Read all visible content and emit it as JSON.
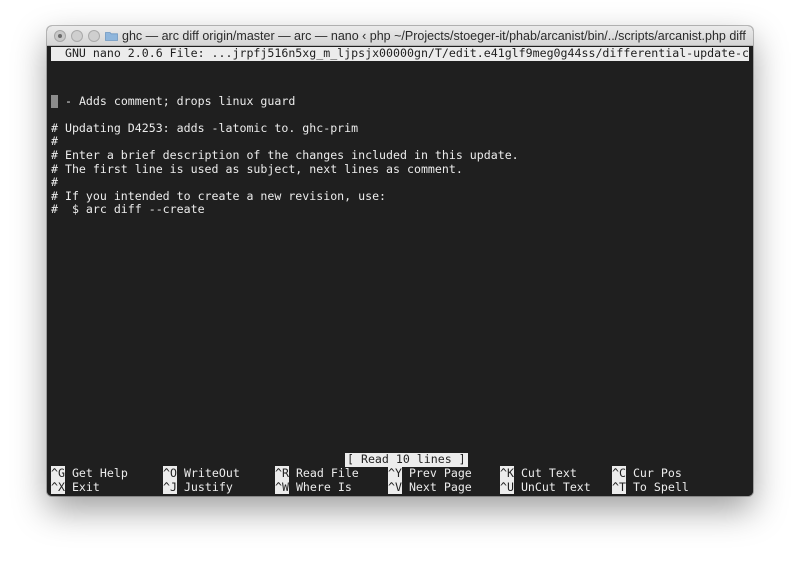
{
  "window": {
    "title": "ghc — arc diff origin/master — arc — nano ‹ php ~/Projects/stoeger-it/phab/arcanist/bin/../scripts/arcanist.php diff origin/m..."
  },
  "nano": {
    "header": "  GNU nano 2.0.6 File: ...jrpfj516n5xg_m_ljpsjx00000gn/T/edit.e41glf9meg0g44ss/differential-update-comments",
    "lines": [
      "",
      " - Adds comment; drops linux guard",
      "",
      "",
      "# Updating D4253: adds -latomic to. ghc-prim",
      "#",
      "# Enter a brief description of the changes included in this update.",
      "# The first line is used as subject, next lines as comment.",
      "#",
      "# If you intended to create a new revision, use:",
      "#  $ arc diff --create"
    ],
    "status": "[ Read 10 lines ]",
    "shortcuts": [
      [
        {
          "key": "^G",
          "label": "Get Help"
        },
        {
          "key": "^O",
          "label": "WriteOut"
        },
        {
          "key": "^R",
          "label": "Read File"
        },
        {
          "key": "^Y",
          "label": "Prev Page"
        },
        {
          "key": "^K",
          "label": "Cut Text"
        },
        {
          "key": "^C",
          "label": "Cur Pos"
        }
      ],
      [
        {
          "key": "^X",
          "label": "Exit"
        },
        {
          "key": "^J",
          "label": "Justify"
        },
        {
          "key": "^W",
          "label": "Where Is"
        },
        {
          "key": "^V",
          "label": "Next Page"
        },
        {
          "key": "^U",
          "label": "UnCut Text"
        },
        {
          "key": "^T",
          "label": "To Spell"
        }
      ]
    ]
  },
  "icons": {
    "close": "close-button-icon",
    "minimize": "minimize-button-icon",
    "zoom": "zoom-button-icon",
    "folder": "folder-icon"
  },
  "colors": {
    "terminal_background": "#1f1f1f",
    "terminal_text": "#ececec",
    "inverse_bar": "#ececec",
    "cursor": "#8c8c8c",
    "folder": "#8fb6dc"
  }
}
